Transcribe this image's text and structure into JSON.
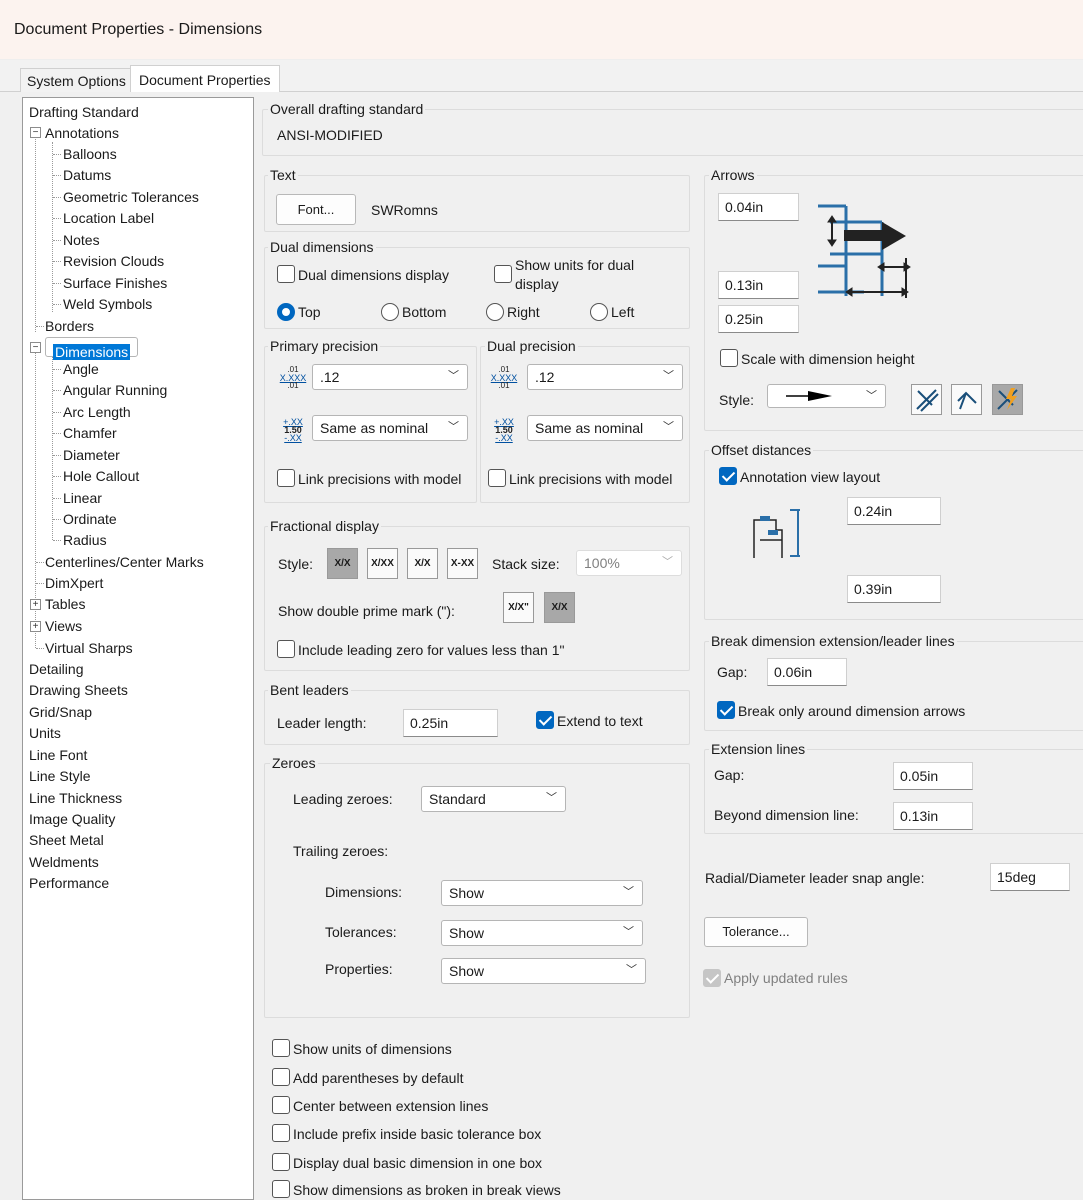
{
  "window": {
    "title": "Document Properties - Dimensions"
  },
  "tabs": [
    {
      "label": "System Options"
    },
    {
      "label": "Document Properties"
    }
  ],
  "tree": {
    "items": [
      {
        "label": "Drafting Standard"
      },
      {
        "label": "Annotations"
      },
      {
        "label": "Balloons"
      },
      {
        "label": "Datums"
      },
      {
        "label": "Geometric Tolerances"
      },
      {
        "label": "Location Label"
      },
      {
        "label": "Notes"
      },
      {
        "label": "Revision Clouds"
      },
      {
        "label": "Surface Finishes"
      },
      {
        "label": "Weld Symbols"
      },
      {
        "label": "Borders"
      },
      {
        "label": "Dimensions"
      },
      {
        "label": "Angle"
      },
      {
        "label": "Angular Running"
      },
      {
        "label": "Arc Length"
      },
      {
        "label": "Chamfer"
      },
      {
        "label": "Diameter"
      },
      {
        "label": "Hole Callout"
      },
      {
        "label": "Linear"
      },
      {
        "label": "Ordinate"
      },
      {
        "label": "Radius"
      },
      {
        "label": "Centerlines/Center Marks"
      },
      {
        "label": "DimXpert"
      },
      {
        "label": "Tables"
      },
      {
        "label": "Views"
      },
      {
        "label": "Virtual Sharps"
      },
      {
        "label": "Detailing"
      },
      {
        "label": "Drawing Sheets"
      },
      {
        "label": "Grid/Snap"
      },
      {
        "label": "Units"
      },
      {
        "label": "Line Font"
      },
      {
        "label": "Line Style"
      },
      {
        "label": "Line Thickness"
      },
      {
        "label": "Image Quality"
      },
      {
        "label": "Sheet Metal"
      },
      {
        "label": "Weldments"
      },
      {
        "label": "Performance"
      }
    ]
  },
  "overall": {
    "label": "Overall drafting standard",
    "value": "ANSI-MODIFIED"
  },
  "text": {
    "label": "Text",
    "font_button": "Font...",
    "font_name": "SWRomns"
  },
  "dual": {
    "label": "Dual dimensions",
    "display_cb": "Dual dimensions display",
    "show_units_cb_1": "Show units for dual",
    "show_units_cb_2": "display",
    "top": "Top",
    "bottom": "Bottom",
    "right": "Right",
    "left": "Left"
  },
  "primary": {
    "label": "Primary precision",
    "value": ".12",
    "tol": "Same as nominal",
    "link": "Link precisions with model",
    "icon_a": ".01",
    "icon_b": "X.XXX",
    "icon_c": ".01",
    "icon_d": "+.XX",
    "icon_e": "1.50",
    "icon_f": "-.XX"
  },
  "dualprec": {
    "label": "Dual precision",
    "value": ".12",
    "tol": "Same as nominal",
    "link": "Link precisions with model"
  },
  "fractional": {
    "label": "Fractional display",
    "style_label": "Style:",
    "stack_label": "Stack size:",
    "stack_value": "100%",
    "double_prime": "Show double prime mark (\"):",
    "leading_zero": "Include leading zero for values less than 1\"",
    "s1": "X/X",
    "s2": "X/XX",
    "s3": "X/X",
    "s4": "X-XX",
    "p1": "X/X\"",
    "p2": "X/X"
  },
  "bent": {
    "label": "Bent leaders",
    "leader_length": "Leader length:",
    "value": "0.25in",
    "extend": "Extend to text"
  },
  "zeroes": {
    "label": "Zeroes",
    "leading": "Leading zeroes:",
    "leading_value": "Standard",
    "trailing": "Trailing zeroes:",
    "dimensions": "Dimensions:",
    "dimensions_value": "Show",
    "tolerances": "Tolerances:",
    "tolerances_value": "Show",
    "properties": "Properties:",
    "properties_value": "Show"
  },
  "bottom_checks": [
    {
      "label": "Show units of dimensions"
    },
    {
      "label": "Add parentheses by default"
    },
    {
      "label": "Center between extension lines"
    },
    {
      "label": "Include prefix inside basic tolerance box"
    },
    {
      "label": "Display dual basic dimension in one box"
    },
    {
      "label": "Show dimensions as broken in break views"
    }
  ],
  "arrows": {
    "label": "Arrows",
    "v1": "0.04in",
    "v2": "0.13in",
    "v3": "0.25in",
    "scale": "Scale with dimension height",
    "style": "Style:"
  },
  "offset": {
    "label": "Offset distances",
    "annotation": "Annotation view layout",
    "v1": "0.24in",
    "v2": "0.39in"
  },
  "break": {
    "label": "Break dimension extension/leader lines",
    "gap": "Gap:",
    "gap_value": "0.06in",
    "only_arrows": "Break only around dimension arrows"
  },
  "ext": {
    "label": "Extension lines",
    "gap": "Gap:",
    "gap_value": "0.05in",
    "beyond": "Beyond dimension line:",
    "beyond_value": "0.13in"
  },
  "radial": {
    "label": "Radial/Diameter leader snap angle:",
    "value": "15deg"
  },
  "tolerance_button": "Tolerance...",
  "apply_rules": "Apply updated rules",
  "colors": {
    "accent": "#0067c0",
    "selection": "#0078d7",
    "diagram_blue": "#2a6fa8"
  }
}
